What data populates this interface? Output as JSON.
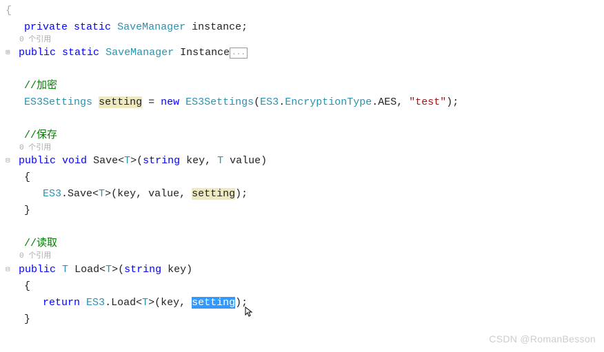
{
  "refs": "0 个引用",
  "line_open": "{",
  "l1": {
    "kw1": "private",
    "kw2": "static",
    "type": "SaveManager",
    "name": " instance;"
  },
  "l2": {
    "kw1": "public",
    "kw2": "static",
    "type": "SaveManager",
    "name": " Instance",
    "box": "..."
  },
  "c_enc": "//加密",
  "l3": {
    "type1": "ES3Settings",
    "name1": "setting",
    "eq": " = ",
    "kw": "new",
    "type2": "ES3Settings",
    "open": "(",
    "type3": "ES3",
    "dot": ".",
    "type4": "EncryptionType",
    "mem": ".AES, ",
    "str": "\"test\"",
    "close": ");"
  },
  "c_save": "//保存",
  "l4": {
    "kw1": "public",
    "kw2": "void",
    "name": " Save<",
    "tparam": "T",
    "after": ">(",
    "kw3": "string",
    "p1": " key, ",
    "tparam2": "T",
    "p2": " value)"
  },
  "brace_open": "{",
  "l5": {
    "type": "ES3",
    "call": ".Save<",
    "tparam": "T",
    "after": ">(key, value, ",
    "hl": "setting",
    "close": ");"
  },
  "brace_close": "}",
  "c_load": "//读取",
  "l6": {
    "kw1": "public",
    "tret": "T",
    "name": " Load<",
    "tparam": "T",
    "after": ">(",
    "kw2": "string",
    "p1": " key)"
  },
  "l7": {
    "kw": "return",
    "type": "ES3",
    "call": ".Load<",
    "tparam": "T",
    "after": ">(key, ",
    "sel": "setting",
    "close": ");"
  },
  "watermark": "CSDN @RomanBesson"
}
